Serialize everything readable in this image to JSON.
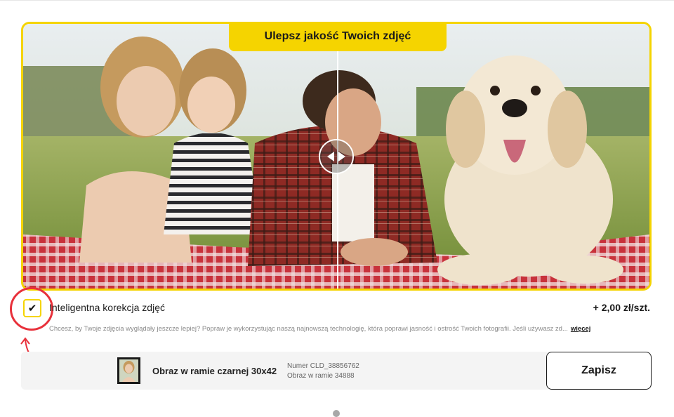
{
  "banner": {
    "title": "Ulepsz jakość Twoich zdjęć"
  },
  "photo": {
    "description": "Family with a child and a golden retriever lying on a red checkered blanket on grass; before/after comparison slider",
    "slider_position": 0.5
  },
  "option": {
    "checked": true,
    "check_glyph": "✔",
    "label": "Inteligentna korekcja zdjęć",
    "price": "+ 2,00 zł/szt.",
    "description": "Chcesz, by Twoje zdjęcia wyglądały jeszcze lepiej? Popraw je wykorzystując naszą najnowszą technologię, która poprawi jasność i ostrość Twoich fotografii. Jeśli używasz zd...",
    "more_label": "więcej"
  },
  "product": {
    "name": "Obraz w ramie czarnej 30x42",
    "number_line": "Numer CLD_38856762",
    "frame_line": "Obraz w ramie 34888"
  },
  "actions": {
    "save_label": "Zapisz"
  },
  "colors": {
    "accent": "#f5d400",
    "highlight": "#e8313b"
  }
}
